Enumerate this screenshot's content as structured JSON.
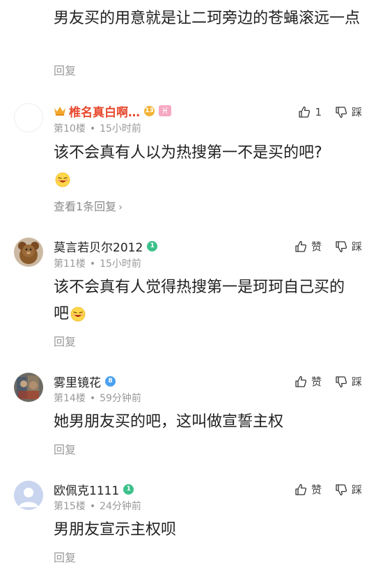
{
  "top": {
    "text": "男友买的用意就是让二珂旁边的苍蝇滚远一点",
    "reply_label": "回复"
  },
  "comments": [
    {
      "username": "椎名真白啊…",
      "level": "13",
      "zodiac": "♓",
      "floor": "第10楼",
      "time": "15小时前",
      "like_label": "1",
      "dislike_label": "踩",
      "content": "该不会真有人以为热搜第一不是买的吧?",
      "reply_label": "查看1条回复"
    },
    {
      "username": "莫言若贝尔2012",
      "level": "1",
      "floor": "第11楼",
      "time": "15小时前",
      "like_label": "赞",
      "dislike_label": "踩",
      "content": "该不会真有人觉得热搜第一是珂珂自己买的吧",
      "reply_label": "回复"
    },
    {
      "username": "雾里镜花",
      "level": "8",
      "floor": "第14楼",
      "time": "59分钟前",
      "like_label": "赞",
      "dislike_label": "踩",
      "content": "她男朋友买的吧，这叫做宣誓主权",
      "reply_label": "回复"
    },
    {
      "username": "欧佩克1111",
      "level": "1",
      "floor": "第15楼",
      "time": "24分钟前",
      "like_label": "赞",
      "dislike_label": "踩",
      "content": "男朋友宣示主权呗",
      "reply_label": "回复"
    }
  ],
  "separator": "•"
}
